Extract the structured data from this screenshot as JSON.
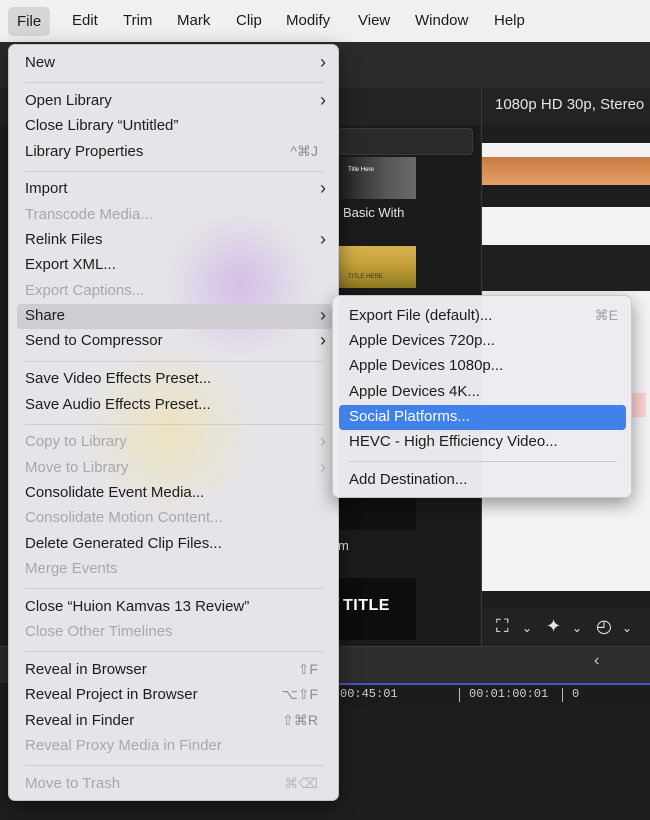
{
  "menubar": {
    "items": [
      {
        "label": "File"
      },
      {
        "label": "Edit"
      },
      {
        "label": "Trim"
      },
      {
        "label": "Mark"
      },
      {
        "label": "Clip"
      },
      {
        "label": "Modify"
      },
      {
        "label": "View"
      },
      {
        "label": "Window"
      },
      {
        "label": "Help"
      }
    ]
  },
  "viewer": {
    "format_label": "1080p HD 30p, Stereo"
  },
  "browser": {
    "thumb1_label": "Basic With",
    "thumb1_small": "Title Here",
    "thumb2_small": "TITLE HERE",
    "thumb3_label": "m",
    "thumb4_title": "TITLE"
  },
  "timeline": {
    "timecodes": [
      "00:45:01",
      "00:01:00:01",
      "0"
    ]
  },
  "file_menu": {
    "items": [
      {
        "label": "New",
        "shortcut": "",
        "submenu": true,
        "enabled": true
      },
      {
        "label": "Open Library",
        "shortcut": "",
        "submenu": true,
        "enabled": true
      },
      {
        "label": "Close Library “Untitled”",
        "shortcut": "",
        "submenu": false,
        "enabled": true
      },
      {
        "label": "Library Properties",
        "shortcut": "^⌘J",
        "submenu": false,
        "enabled": true
      },
      {
        "label": "Import",
        "shortcut": "",
        "submenu": true,
        "enabled": true
      },
      {
        "label": "Transcode Media...",
        "shortcut": "",
        "submenu": false,
        "enabled": false
      },
      {
        "label": "Relink Files",
        "shortcut": "",
        "submenu": true,
        "enabled": true
      },
      {
        "label": "Export XML...",
        "shortcut": "",
        "submenu": false,
        "enabled": true
      },
      {
        "label": "Export Captions...",
        "shortcut": "",
        "submenu": false,
        "enabled": false
      },
      {
        "label": "Share",
        "shortcut": "",
        "submenu": true,
        "enabled": true,
        "highlighted": true
      },
      {
        "label": "Send to Compressor",
        "shortcut": "",
        "submenu": true,
        "enabled": true
      },
      {
        "label": "Save Video Effects Preset...",
        "shortcut": "",
        "submenu": false,
        "enabled": true
      },
      {
        "label": "Save Audio Effects Preset...",
        "shortcut": "",
        "submenu": false,
        "enabled": true
      },
      {
        "label": "Copy to Library",
        "shortcut": "",
        "submenu": true,
        "enabled": false
      },
      {
        "label": "Move to Library",
        "shortcut": "",
        "submenu": true,
        "enabled": false
      },
      {
        "label": "Consolidate Event Media...",
        "shortcut": "",
        "submenu": false,
        "enabled": true
      },
      {
        "label": "Consolidate Motion Content...",
        "shortcut": "",
        "submenu": false,
        "enabled": false
      },
      {
        "label": "Delete Generated Clip Files...",
        "shortcut": "",
        "submenu": false,
        "enabled": true
      },
      {
        "label": "Merge Events",
        "shortcut": "",
        "submenu": false,
        "enabled": false
      },
      {
        "label": "Close “Huion Kamvas 13 Review”",
        "shortcut": "",
        "submenu": false,
        "enabled": true
      },
      {
        "label": "Close Other Timelines",
        "shortcut": "",
        "submenu": false,
        "enabled": false
      },
      {
        "label": "Reveal in Browser",
        "shortcut": "⇧F",
        "submenu": false,
        "enabled": true
      },
      {
        "label": "Reveal Project in Browser",
        "shortcut": "⌥⇧F",
        "submenu": false,
        "enabled": true
      },
      {
        "label": "Reveal in Finder",
        "shortcut": "⇧⌘R",
        "submenu": false,
        "enabled": true
      },
      {
        "label": "Reveal Proxy Media in Finder",
        "shortcut": "",
        "submenu": false,
        "enabled": false
      },
      {
        "label": "Move to Trash",
        "shortcut": "⌘⌫",
        "submenu": false,
        "enabled": false
      }
    ]
  },
  "share_menu": {
    "items": [
      {
        "label": "Export File (default)...",
        "shortcut": "⌘E"
      },
      {
        "label": "Apple Devices 720p...",
        "shortcut": ""
      },
      {
        "label": "Apple Devices 1080p...",
        "shortcut": ""
      },
      {
        "label": "Apple Devices 4K...",
        "shortcut": ""
      },
      {
        "label": "Social Platforms...",
        "shortcut": "",
        "selected": true
      },
      {
        "label": "HEVC - High Efficiency Video...",
        "shortcut": ""
      },
      {
        "label": "Add Destination...",
        "shortcut": ""
      }
    ]
  },
  "colors": {
    "menu_bg": "#ECEAEE",
    "selection_blue": "#3E82EA",
    "app_dark": "#1E1E1E"
  }
}
